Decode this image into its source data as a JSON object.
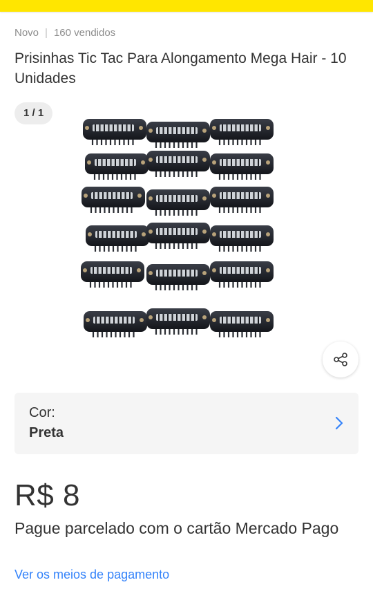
{
  "header": {
    "bar_color": "#ffe600"
  },
  "product": {
    "condition": "Novo",
    "separator": "|",
    "sold": "160 vendidos",
    "title": "Prisinhas Tic Tac Para Alongamento Mega Hair - 10 Unidades",
    "gallery_counter": "1 / 1",
    "image_icon": "hair-clips-photo",
    "share_icon": "share-icon"
  },
  "variant": {
    "label": "Cor:",
    "value": "Preta",
    "chevron_icon": "chevron-right-icon"
  },
  "pricing": {
    "price": "R$ 8",
    "installments": "Pague parcelado com o cartão Mercado Pago",
    "payment_link": "Ver os meios de pagamento",
    "link_color": "#3483fa"
  }
}
